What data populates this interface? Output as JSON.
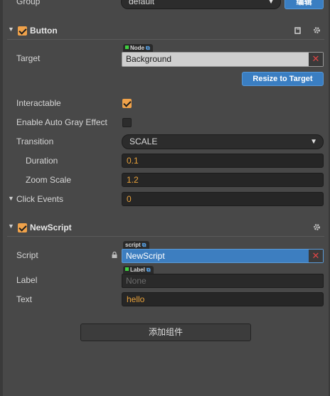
{
  "top_row": {
    "label": "Group",
    "value": "default",
    "edit_button": "编辑"
  },
  "button_section": {
    "title": "Button",
    "target": {
      "label": "Target",
      "tag": "Node",
      "value": "Background"
    },
    "resize_button": "Resize to Target",
    "interactable": {
      "label": "Interactable",
      "checked": true
    },
    "auto_gray": {
      "label": "Enable Auto Gray Effect",
      "checked": false
    },
    "transition": {
      "label": "Transition",
      "value": "SCALE"
    },
    "duration": {
      "label": "Duration",
      "value": "0.1"
    },
    "zoom_scale": {
      "label": "Zoom Scale",
      "value": "1.2"
    },
    "click_events": {
      "label": "Click Events",
      "value": "0"
    }
  },
  "newscript_section": {
    "title": "NewScript",
    "script": {
      "label": "Script",
      "tag": "script",
      "value": "NewScript"
    },
    "label_field": {
      "label": "Label",
      "tag": "Label",
      "placeholder": "None"
    },
    "text_field": {
      "label": "Text",
      "value": "hello"
    }
  },
  "add_component_button": "添加组件",
  "colors": {
    "accent_orange": "#e9a23b",
    "button_blue": "#3a7ec2",
    "remove_red": "#e04545"
  }
}
